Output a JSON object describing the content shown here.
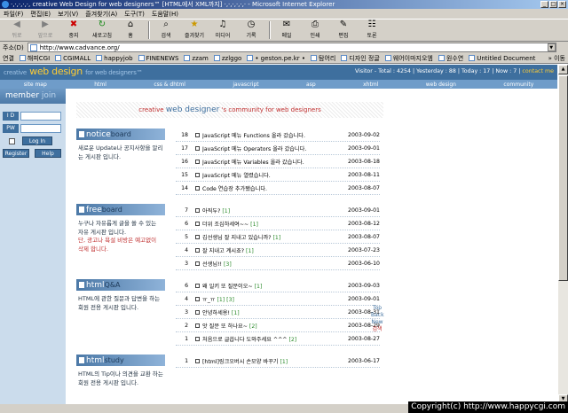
{
  "window": {
    "title": "·,·,·,·,·, creative Web Design for web designers™ [HTML에서 XML까지] ·,·,·,·,·,· - Microsoft Internet Explorer"
  },
  "menu": [
    "파일(F)",
    "편집(E)",
    "보기(V)",
    "즐겨찾기(A)",
    "도구(T)",
    "도움말(H)"
  ],
  "toolbar": [
    {
      "label": "뒤로",
      "icon": "back-arrow-icon",
      "enabled": false
    },
    {
      "label": "앞으로",
      "icon": "forward-arrow-icon",
      "enabled": false
    },
    {
      "label": "중지",
      "icon": "stop-icon",
      "enabled": true
    },
    {
      "label": "새로고침",
      "icon": "refresh-icon",
      "enabled": true
    },
    {
      "label": "홈",
      "icon": "home-icon",
      "enabled": true
    },
    {
      "label": "검색",
      "icon": "search-icon",
      "enabled": true
    },
    {
      "label": "즐겨찾기",
      "icon": "favorites-icon",
      "enabled": true
    },
    {
      "label": "미디어",
      "icon": "media-icon",
      "enabled": true
    },
    {
      "label": "기록",
      "icon": "history-icon",
      "enabled": true
    },
    {
      "label": "메일",
      "icon": "mail-icon",
      "enabled": true
    },
    {
      "label": "인쇄",
      "icon": "print-icon",
      "enabled": true
    },
    {
      "label": "편집",
      "icon": "edit-icon",
      "enabled": true
    },
    {
      "label": "토론",
      "icon": "discuss-icon",
      "enabled": true
    }
  ],
  "address": {
    "label": "주소(D)",
    "url": "http://www.cadvance.org/"
  },
  "links": {
    "label": "연결",
    "items": [
      "해피CGI",
      "CGIMALL",
      "happyjob",
      "FINENEWS",
      "zzam",
      "zzlggo",
      "• geston.pe.kr •",
      "탐어리",
      "디자인 정글",
      "웨어이마지오엠",
      "원수연",
      "Untitled Document"
    ],
    "more": "»  이동"
  },
  "site": {
    "logo_small": "creative",
    "logo_main": "web design",
    "logo_sub": "for web designers™",
    "stats": "Visitor - Total : 4254 | Yesterday : 88 | Today : 17 | Now : 7 |",
    "contact": "contact me",
    "nav": [
      "site map",
      "html",
      "css & dhtml",
      "javascript",
      "asp",
      "xhtml",
      "web design",
      "community"
    ]
  },
  "member": {
    "title": "member",
    "title_join": "join",
    "id_label": "I D",
    "pw_label": "PW",
    "login": "Log In",
    "register": "Register",
    "help": "Help"
  },
  "banner": {
    "pre": "creative ",
    "main": "web designer",
    "post": " 's community for web designers"
  },
  "boards": [
    {
      "title_bold": "notice",
      "title_rest": "board",
      "desc": "새로운 Update나 공지사항을 알리는 게시판 입니다.",
      "warn": "",
      "rows": [
        {
          "n": "18",
          "text": "JavaScript 메뉴 Functions 올라 갔습니다.",
          "c": "",
          "date": "2003-09-02"
        },
        {
          "n": "17",
          "text": "JavaScript 메뉴 Operators 올라 갔습니다.",
          "c": "",
          "date": "2003-09-01"
        },
        {
          "n": "16",
          "text": "JavaScript 메뉴 Variables 올라 갔습니다.",
          "c": "",
          "date": "2003-08-18"
        },
        {
          "n": "15",
          "text": "JavaScript 메뉴 열렸습니다.",
          "c": "",
          "date": "2003-08-11"
        },
        {
          "n": "14",
          "text": "Code 연습장 추가됐습니다.",
          "c": "",
          "date": "2003-08-07"
        }
      ]
    },
    {
      "title_bold": "free",
      "title_rest": "board",
      "desc": "누구나 자유롭게 글을 쓸 수 있는 자유 게시판 입니다.",
      "warn": "단, 광고나 욕설 비방은 예고없이 삭제 합니다.",
      "rows": [
        {
          "n": "7",
          "text": "아직두?",
          "c": "[1]",
          "date": "2003-09-01"
        },
        {
          "n": "6",
          "text": "더위 조심하세여~~",
          "c": "[1]",
          "date": "2003-08-12"
        },
        {
          "n": "5",
          "text": "김선생님 잘 지내고 있습니까?",
          "c": "[1]",
          "date": "2003-08-07"
        },
        {
          "n": "4",
          "text": "잘 지내고 계시죠?",
          "c": "[1]",
          "date": "2003-07-23"
        },
        {
          "n": "3",
          "text": "선생님!!",
          "c": "[3]",
          "date": "2003-06-10"
        }
      ]
    },
    {
      "title_bold": "html",
      "title_rest": "Q&A",
      "desc": "HTML에 관한 질문과 답변을 하는 회원 전용 게시판 입니다.",
      "warn": "",
      "rows": [
        {
          "n": "6",
          "text": "왜 일키 또 질문이오~",
          "c": "[1]",
          "date": "2003-09-03"
        },
        {
          "n": "4",
          "text": "ㅠ_ㅠ",
          "c": "[1] [3]",
          "date": "2003-09-01"
        },
        {
          "n": "3",
          "text": "안녕하세용!",
          "c": "[1]",
          "date": "2003-08-31"
        },
        {
          "n": "2",
          "text": "앗 질문 또 하나요~",
          "c": "[2]",
          "date": "2003-08-29"
        },
        {
          "n": "1",
          "text": "처음으로 글씁니다 도와주세요 ^^^",
          "c": "[2]",
          "date": "2003-08-27"
        }
      ]
    },
    {
      "title_bold": "html",
      "title_rest": "study",
      "desc": "HTML의 Tip이나 의견을 교환 하는 회원 전용 게시판 입니다.",
      "warn": "",
      "rows": [
        {
          "n": "1",
          "text": "[html]링크오버시 손모양 바꾸기",
          "c": "[1]",
          "date": "2003-06-17"
        }
      ]
    }
  ],
  "topback": {
    "l1": "Top",
    "l2": "Back",
    "l3": "New",
    "l4": "검색"
  },
  "copyright": "Copyright(c) http://www.happycgi.com"
}
